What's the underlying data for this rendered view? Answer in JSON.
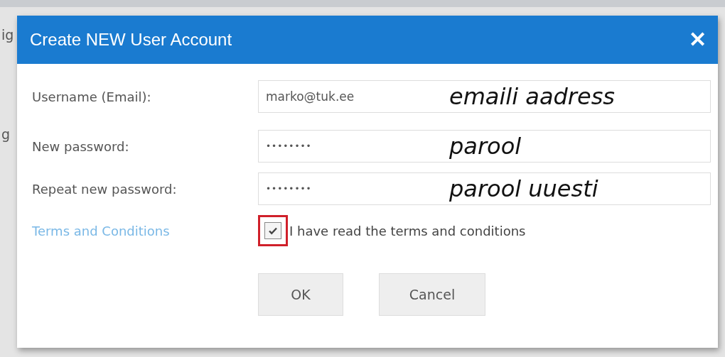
{
  "background_texts": [
    "ig",
    "g"
  ],
  "dialog": {
    "title": "Create NEW User Account",
    "close_label": "✕"
  },
  "fields": [
    {
      "label": "Username (Email):",
      "kind": "text",
      "value": "marko@tuk.ee",
      "annotation": "emaili aadress"
    },
    {
      "label": "New password:",
      "kind": "password",
      "value": "••••••••",
      "annotation": "parool"
    },
    {
      "label": "Repeat new password:",
      "kind": "password",
      "value": "••••••••",
      "annotation": "parool uuesti"
    }
  ],
  "terms": {
    "link": "Terms and Conditions",
    "checkbox_label": "I have read the terms and conditions",
    "checked": true,
    "highlighted": true
  },
  "buttons": [
    "OK",
    "Cancel"
  ]
}
